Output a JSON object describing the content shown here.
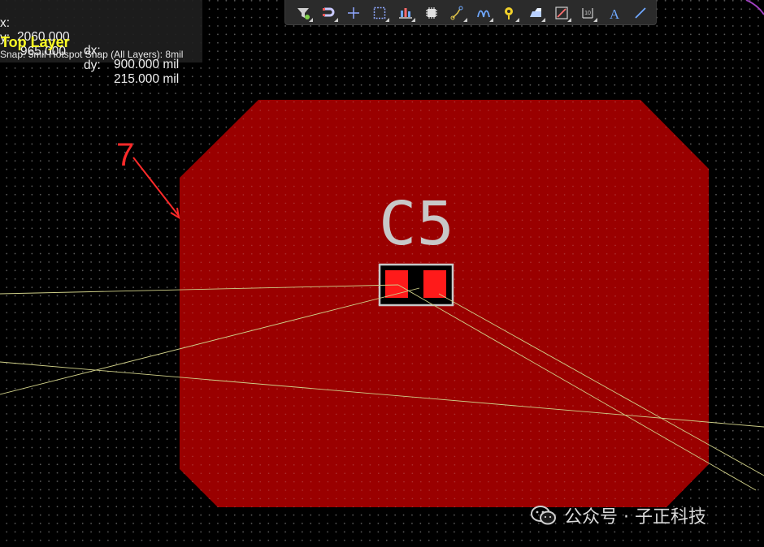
{
  "hud": {
    "x_label": "x:",
    "x_value": "2060.000",
    "dx_label": "dx:",
    "dx_value": "900.000 mil",
    "y_label": "y:",
    "y_value": "965.000",
    "dy_label": "dy:",
    "dy_value": "215.000 mil",
    "layer": "Top Layer",
    "snap": "Snap: 5mil Hotspot Snap (All Layers): 8mil"
  },
  "toolbar": [
    {
      "name": "filter-icon",
      "color": "#d0d0d0"
    },
    {
      "name": "snap-magnet-icon",
      "color": "#c9c9ff"
    },
    {
      "name": "add-icon",
      "color": "#8fa8ff"
    },
    {
      "name": "select-rectangle-icon",
      "color": "#8fa8ff"
    },
    {
      "name": "align-icon",
      "color": "#ff8a8a"
    },
    {
      "name": "component-icon",
      "color": "#d0d0d0"
    },
    {
      "name": "route-track-icon",
      "color": "#e6c84a"
    },
    {
      "name": "interactive-routing-icon",
      "color": "#6fa8ff"
    },
    {
      "name": "via-icon",
      "color": "#f2d12a"
    },
    {
      "name": "polygon-pour-icon",
      "color": "#b8d0ff"
    },
    {
      "name": "region-icon",
      "color": "#ff7070"
    },
    {
      "name": "dimension-icon",
      "color": "#d0d0d0"
    },
    {
      "name": "text-icon",
      "color": "#6fa8ff"
    },
    {
      "name": "line-icon",
      "color": "#6fa8ff"
    }
  ],
  "pcb": {
    "polygon_color": "#9a0000",
    "pad_color": "#ff1a1a",
    "silkscreen_color": "#c8c8c8",
    "ratsnest_color": "#cfcf88",
    "designator": "C5"
  },
  "annotation": {
    "label": "7",
    "color": "#ff2a2a"
  },
  "watermark": {
    "text": "公众号 · 子正科技"
  }
}
